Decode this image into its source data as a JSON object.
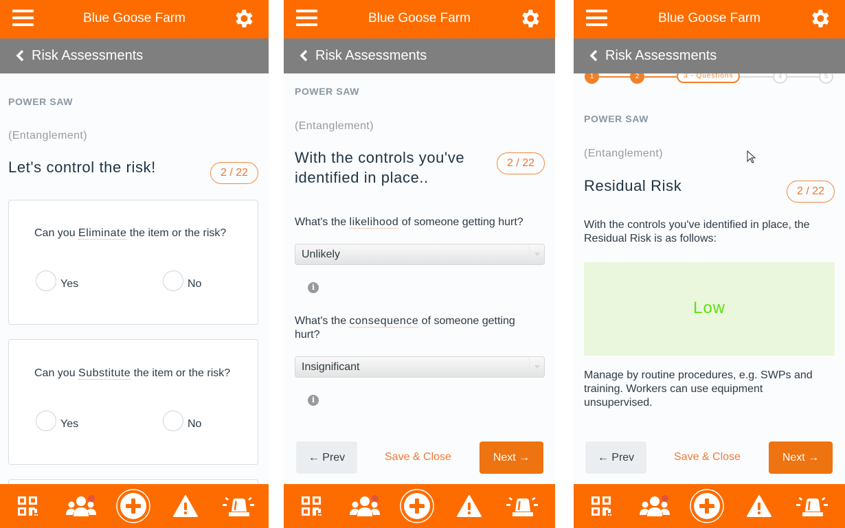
{
  "app": {
    "title": "Blue Goose Farm",
    "back_label": "Risk Assessments",
    "menu_icon": "hamburger-menu-icon",
    "settings_icon": "gear-icon",
    "brand_color": "#fe6c00",
    "subbar_color": "#7f7f7f"
  },
  "common": {
    "item_label": "POWER SAW",
    "hazard": "(Entanglement)",
    "counter": "2 / 22"
  },
  "bottom_nav": [
    {
      "name": "qr-code-scan",
      "icon": "qr-code-icon"
    },
    {
      "name": "team",
      "icon": "people-icon",
      "badge": true,
      "badge_color": "#e0533f"
    },
    {
      "name": "add",
      "icon": "plus-circle-icon"
    },
    {
      "name": "hazards",
      "icon": "warning-triangle-icon"
    },
    {
      "name": "emergency",
      "icon": "siren-icon"
    }
  ],
  "screen1": {
    "heading": "Let's control the risk!",
    "questions": [
      {
        "prefix": "Can you ",
        "keyword": "Eliminate",
        "suffix": " the item or the risk?",
        "options": [
          "Yes",
          "No"
        ],
        "selected": null
      },
      {
        "prefix": "Can you ",
        "keyword": "Substitute",
        "suffix": " the item or the risk?",
        "options": [
          "Yes",
          "No"
        ],
        "selected": null
      }
    ]
  },
  "screen2": {
    "heading": "With the controls you've identified in place..",
    "fields": [
      {
        "prefix": "What's the ",
        "keyword": "likelihood",
        "suffix": " of someone getting hurt?",
        "value": "Unlikely"
      },
      {
        "prefix": "What's the ",
        "keyword": "consequence",
        "suffix": " of someone getting hurt?",
        "value": "Insignificant"
      }
    ],
    "info_icon": "info-icon"
  },
  "screen3": {
    "stepper": {
      "steps": [
        "1",
        "2",
        "3",
        "4",
        "5"
      ],
      "current_step": 3,
      "current_label": "3  - Questions"
    },
    "heading": "Residual Risk",
    "intro": "With the controls you've identified in place, the Residual Risk is as follows:",
    "risk_level": "Low",
    "risk_color": "#5fe012",
    "risk_bg": "#eaf7dc",
    "guidance": "Manage by routine procedures, e.g. SWPs and training. Workers can use equipment unsupervised."
  },
  "footer": {
    "prev_label": "← Prev",
    "save_label": "Save & Close",
    "next_label": "Next →"
  }
}
